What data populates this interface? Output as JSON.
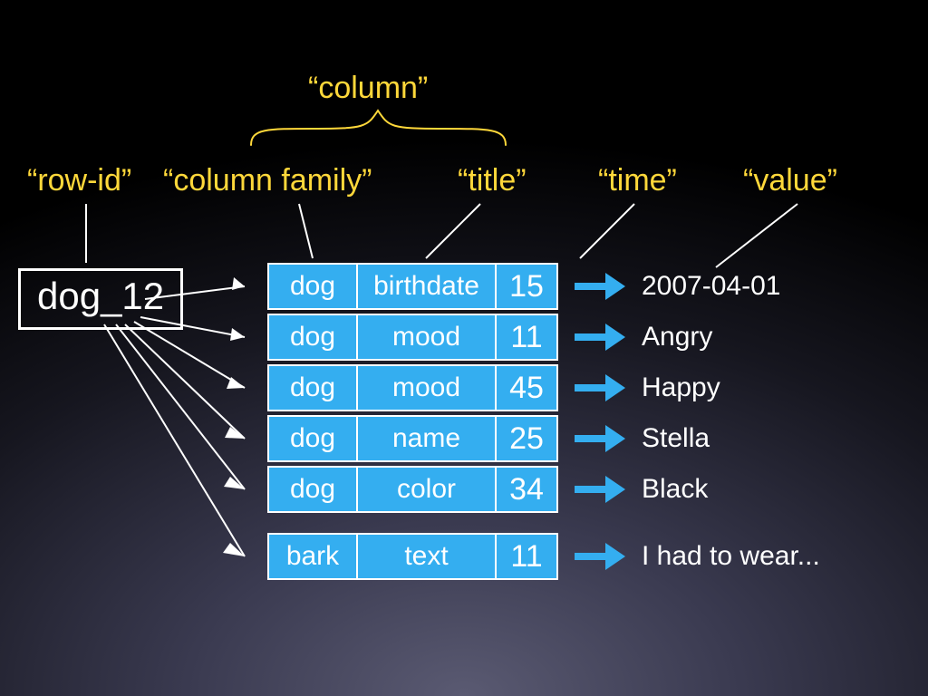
{
  "labels": {
    "column": "“column”",
    "row_id": "“row-id”",
    "column_family": "“column family”",
    "title": "“title”",
    "time": "“time”",
    "value": "“value”"
  },
  "row_id": "dog_12",
  "rows": [
    {
      "cf": "dog",
      "title": "birthdate",
      "time": "15",
      "value": "2007-04-01"
    },
    {
      "cf": "dog",
      "title": "mood",
      "time": "11",
      "value": "Angry"
    },
    {
      "cf": "dog",
      "title": "mood",
      "time": "45",
      "value": "Happy"
    },
    {
      "cf": "dog",
      "title": "name",
      "time": "25",
      "value": "Stella"
    },
    {
      "cf": "dog",
      "title": "color",
      "time": "34",
      "value": "Black"
    },
    {
      "cf": "bark",
      "title": "text",
      "time": "11",
      "value": "I had to wear..."
    }
  ],
  "colors": {
    "accent": "#34aef0",
    "label": "#ffd83a"
  }
}
